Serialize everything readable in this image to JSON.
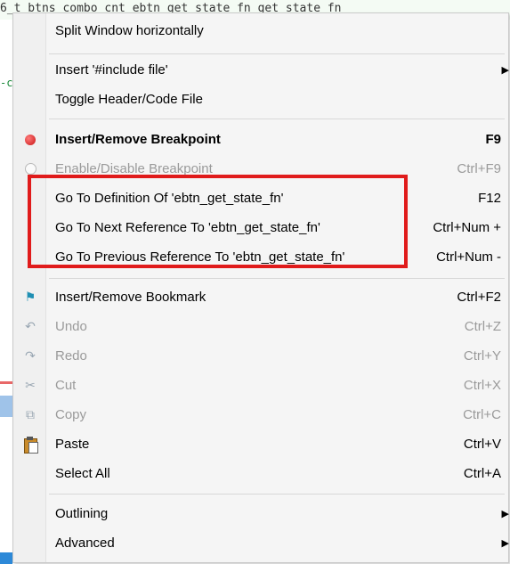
{
  "background": {
    "code_line": "6_t btns_combo_cnt  ebtn_get_state_fn  get_state_fn  ",
    "left_fragment": "-c"
  },
  "menu": {
    "items": [
      {
        "label": "Split Window horizontally"
      },
      {
        "label": "Insert '#include file'",
        "submenu": true
      },
      {
        "label": "Toggle Header/Code File"
      },
      {
        "label": "Insert/Remove Breakpoint",
        "shortcut": "F9",
        "icon": "breakpoint-icon",
        "bold": true
      },
      {
        "label": "Enable/Disable Breakpoint",
        "shortcut": "Ctrl+F9",
        "icon": "breakpoint-disabled-icon",
        "disabled": true
      },
      {
        "label": "Go To Definition Of 'ebtn_get_state_fn'",
        "shortcut": "F12"
      },
      {
        "label": "Go To Next Reference To 'ebtn_get_state_fn'",
        "shortcut": "Ctrl+Num +"
      },
      {
        "label": "Go To Previous Reference To 'ebtn_get_state_fn'",
        "shortcut": "Ctrl+Num -"
      },
      {
        "label": "Insert/Remove Bookmark",
        "shortcut": "Ctrl+F2",
        "icon": "bookmark-flag-icon"
      },
      {
        "label": "Undo",
        "shortcut": "Ctrl+Z",
        "icon": "undo-icon",
        "disabled": true
      },
      {
        "label": "Redo",
        "shortcut": "Ctrl+Y",
        "icon": "redo-icon",
        "disabled": true
      },
      {
        "label": "Cut",
        "shortcut": "Ctrl+X",
        "icon": "cut-icon",
        "disabled": true
      },
      {
        "label": "Copy",
        "shortcut": "Ctrl+C",
        "icon": "copy-icon",
        "disabled": true
      },
      {
        "label": "Paste",
        "shortcut": "Ctrl+V",
        "icon": "paste-icon"
      },
      {
        "label": "Select All",
        "shortcut": "Ctrl+A"
      },
      {
        "label": "Outlining",
        "submenu": true
      },
      {
        "label": "Advanced",
        "submenu": true
      }
    ]
  },
  "colors": {
    "menu_bg": "#f5f5f5",
    "highlight_box": "#e01b1b",
    "disabled_text": "#9a9a9a"
  }
}
